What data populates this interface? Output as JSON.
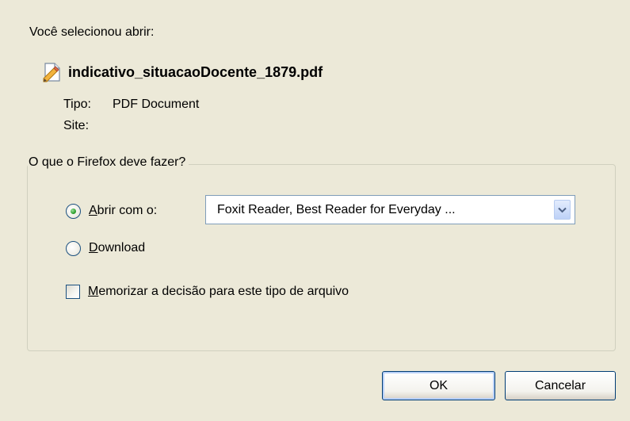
{
  "dialog": {
    "intro_text": "Você selecionou abrir:",
    "file": {
      "icon": "pdf-document-icon",
      "name": "indicativo_situacaoDocente_1879.pdf"
    },
    "details": {
      "type_label": "Tipo:",
      "type_value": "PDF Document",
      "site_label": "Site:",
      "site_value": ""
    },
    "action_group": {
      "legend": "O que o Firefox deve fazer?",
      "open_with": {
        "label": "Abrir com o:",
        "selected": true,
        "app_value": "Foxit Reader, Best Reader for Everyday ..."
      },
      "download": {
        "label": "Download",
        "selected": false
      },
      "remember": {
        "label": "Memorizar a decisão para este tipo de arquivo",
        "checked": false
      }
    },
    "buttons": {
      "ok": "OK",
      "cancel": "Cancelar"
    }
  }
}
